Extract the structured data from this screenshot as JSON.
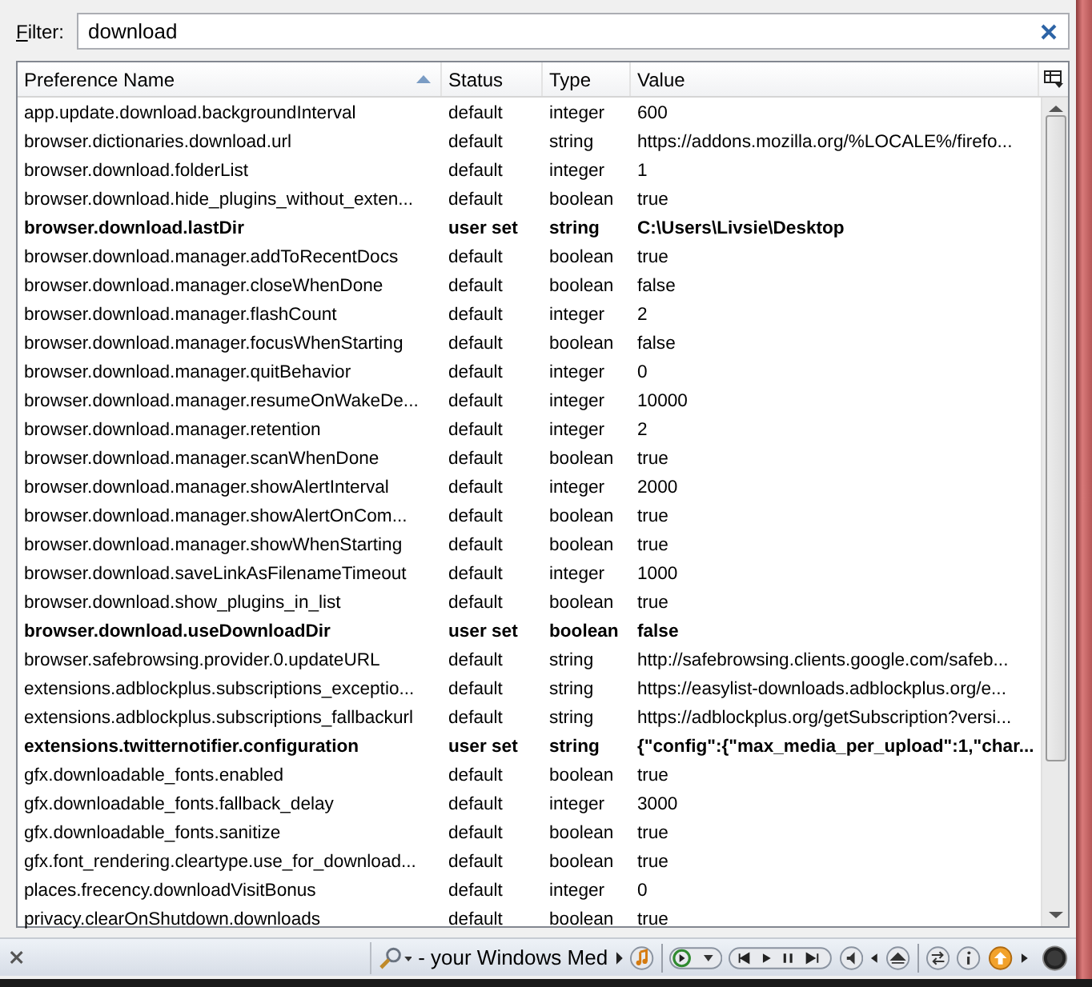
{
  "filter": {
    "label": "Filter:",
    "value": "download"
  },
  "columns": [
    {
      "label": "Preference Name",
      "sorted": true
    },
    {
      "label": "Status",
      "sorted": false
    },
    {
      "label": "Type",
      "sorted": false
    },
    {
      "label": "Value",
      "sorted": false
    }
  ],
  "rows": [
    {
      "name": "app.update.download.backgroundInterval",
      "status": "default",
      "type": "integer",
      "value": "600",
      "modified": false
    },
    {
      "name": "browser.dictionaries.download.url",
      "status": "default",
      "type": "string",
      "value": "https://addons.mozilla.org/%LOCALE%/firefo...",
      "modified": false
    },
    {
      "name": "browser.download.folderList",
      "status": "default",
      "type": "integer",
      "value": "1",
      "modified": false
    },
    {
      "name": "browser.download.hide_plugins_without_exten...",
      "status": "default",
      "type": "boolean",
      "value": "true",
      "modified": false
    },
    {
      "name": "browser.download.lastDir",
      "status": "user set",
      "type": "string",
      "value": "C:\\Users\\Livsie\\Desktop",
      "modified": true
    },
    {
      "name": "browser.download.manager.addToRecentDocs",
      "status": "default",
      "type": "boolean",
      "value": "true",
      "modified": false
    },
    {
      "name": "browser.download.manager.closeWhenDone",
      "status": "default",
      "type": "boolean",
      "value": "false",
      "modified": false
    },
    {
      "name": "browser.download.manager.flashCount",
      "status": "default",
      "type": "integer",
      "value": "2",
      "modified": false
    },
    {
      "name": "browser.download.manager.focusWhenStarting",
      "status": "default",
      "type": "boolean",
      "value": "false",
      "modified": false
    },
    {
      "name": "browser.download.manager.quitBehavior",
      "status": "default",
      "type": "integer",
      "value": "0",
      "modified": false
    },
    {
      "name": "browser.download.manager.resumeOnWakeDe...",
      "status": "default",
      "type": "integer",
      "value": "10000",
      "modified": false
    },
    {
      "name": "browser.download.manager.retention",
      "status": "default",
      "type": "integer",
      "value": "2",
      "modified": false
    },
    {
      "name": "browser.download.manager.scanWhenDone",
      "status": "default",
      "type": "boolean",
      "value": "true",
      "modified": false
    },
    {
      "name": "browser.download.manager.showAlertInterval",
      "status": "default",
      "type": "integer",
      "value": "2000",
      "modified": false
    },
    {
      "name": "browser.download.manager.showAlertOnCom...",
      "status": "default",
      "type": "boolean",
      "value": "true",
      "modified": false
    },
    {
      "name": "browser.download.manager.showWhenStarting",
      "status": "default",
      "type": "boolean",
      "value": "true",
      "modified": false
    },
    {
      "name": "browser.download.saveLinkAsFilenameTimeout",
      "status": "default",
      "type": "integer",
      "value": "1000",
      "modified": false
    },
    {
      "name": "browser.download.show_plugins_in_list",
      "status": "default",
      "type": "boolean",
      "value": "true",
      "modified": false
    },
    {
      "name": "browser.download.useDownloadDir",
      "status": "user set",
      "type": "boolean",
      "value": "false",
      "modified": true
    },
    {
      "name": "browser.safebrowsing.provider.0.updateURL",
      "status": "default",
      "type": "string",
      "value": "http://safebrowsing.clients.google.com/safeb...",
      "modified": false
    },
    {
      "name": "extensions.adblockplus.subscriptions_exceptio...",
      "status": "default",
      "type": "string",
      "value": "https://easylist-downloads.adblockplus.org/e...",
      "modified": false
    },
    {
      "name": "extensions.adblockplus.subscriptions_fallbackurl",
      "status": "default",
      "type": "string",
      "value": "https://adblockplus.org/getSubscription?versi...",
      "modified": false
    },
    {
      "name": "extensions.twitternotifier.configuration",
      "status": "user set",
      "type": "string",
      "value": "{\"config\":{\"max_media_per_upload\":1,\"char...",
      "modified": true
    },
    {
      "name": "gfx.downloadable_fonts.enabled",
      "status": "default",
      "type": "boolean",
      "value": "true",
      "modified": false
    },
    {
      "name": "gfx.downloadable_fonts.fallback_delay",
      "status": "default",
      "type": "integer",
      "value": "3000",
      "modified": false
    },
    {
      "name": "gfx.downloadable_fonts.sanitize",
      "status": "default",
      "type": "boolean",
      "value": "true",
      "modified": false
    },
    {
      "name": "gfx.font_rendering.cleartype.use_for_download...",
      "status": "default",
      "type": "boolean",
      "value": "true",
      "modified": false
    },
    {
      "name": "places.frecency.downloadVisitBonus",
      "status": "default",
      "type": "integer",
      "value": "0",
      "modified": false
    },
    {
      "name": "privacy.clearOnShutdown.downloads",
      "status": "default",
      "type": "boolean",
      "value": "true",
      "modified": false
    }
  ],
  "status_bar": {
    "media_title": "- your Windows Med"
  }
}
